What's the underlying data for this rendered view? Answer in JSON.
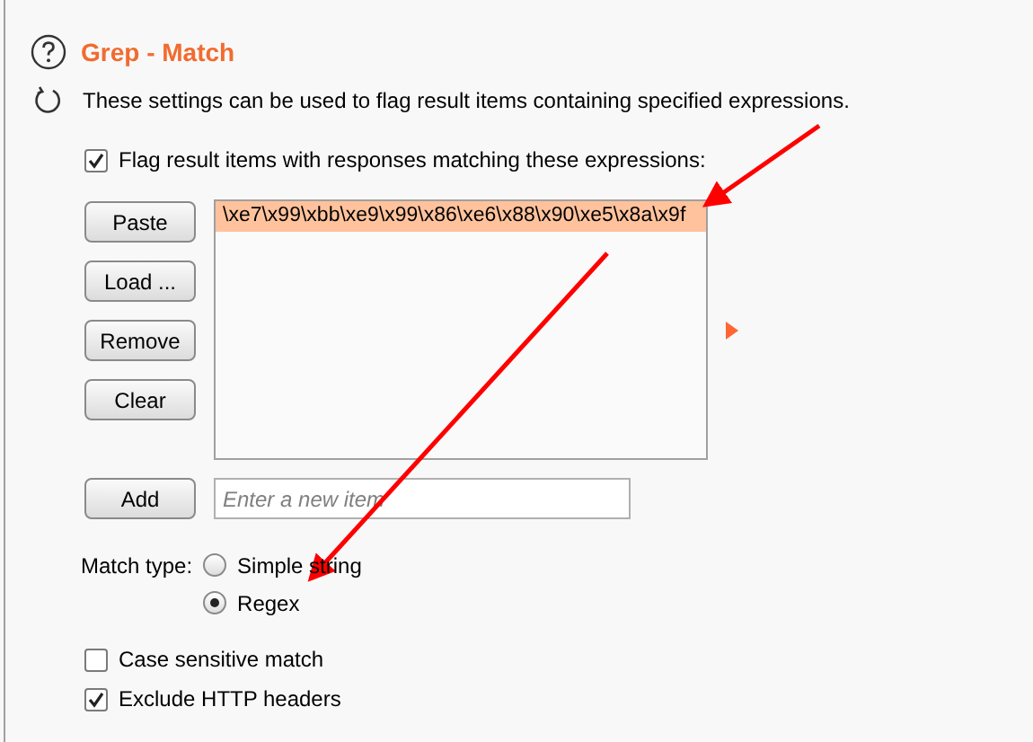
{
  "title": "Grep - Match",
  "description": "These settings can be used to flag result items containing specified expressions.",
  "flag_option": {
    "label": "Flag result items with responses matching these expressions:",
    "checked": true
  },
  "buttons": [
    "Paste",
    "Load ...",
    "Remove",
    "Clear"
  ],
  "items": [
    {
      "text": "\\xe7\\x99\\xbb\\xe9\\x99\\x86\\xe6\\x88\\x90\\xe5\\x8a\\x9f",
      "selected": true
    }
  ],
  "add_button": "Add",
  "new_item": {
    "placeholder": "Enter a new item"
  },
  "match_type": {
    "label": "Match type:",
    "options": [
      {
        "label": "Simple string",
        "selected": false
      },
      {
        "label": "Regex",
        "selected": true
      }
    ]
  },
  "options": [
    {
      "label": "Case sensitive match",
      "checked": false
    },
    {
      "label": "Exclude HTTP headers",
      "checked": true
    }
  ]
}
